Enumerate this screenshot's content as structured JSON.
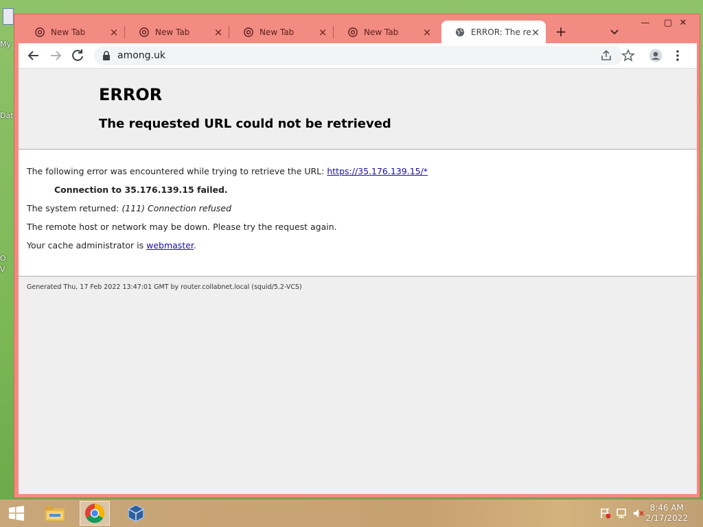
{
  "desktop": {
    "labels": [
      "My",
      "Dat",
      "O",
      "V"
    ]
  },
  "browser": {
    "tabs": [
      {
        "title": "New Tab",
        "active": false
      },
      {
        "title": "New Tab",
        "active": false
      },
      {
        "title": "New Tab",
        "active": false
      },
      {
        "title": "New Tab",
        "active": false
      },
      {
        "title": "ERROR: The requ",
        "active": true
      }
    ],
    "new_tab_label": "+",
    "window_controls": {
      "minimize": "—",
      "maximize": "▢",
      "close": "✕"
    },
    "address": "among.uk",
    "colors": {
      "frame": "#f28b82",
      "tab_active": "#ffffff",
      "link": "#1a0dab"
    }
  },
  "page": {
    "title": "ERROR",
    "subtitle": "The requested URL could not be retrieved",
    "line1_text": "The following error was encountered while trying to retrieve the URL: ",
    "line1_link": "https://35.176.139.15/*",
    "line2": "Connection to 35.176.139.15 failed.",
    "line3_text": "The system returned: ",
    "line3_emph": "(111) Connection refused",
    "line4": "The remote host or network may be down. Please try the request again.",
    "line5_text": "Your cache administrator is ",
    "line5_link": "webmaster",
    "line5_end": ".",
    "footer": "Generated Thu, 17 Feb 2022 13:47:01 GMT by router.collabnet.local (squid/5.2-VCS)"
  },
  "taskbar": {
    "apps": [
      "start-icon",
      "file-explorer-icon",
      "chrome-icon",
      "virtualbox-icon"
    ],
    "time": "8:46 AM",
    "date": "2/17/2022"
  }
}
